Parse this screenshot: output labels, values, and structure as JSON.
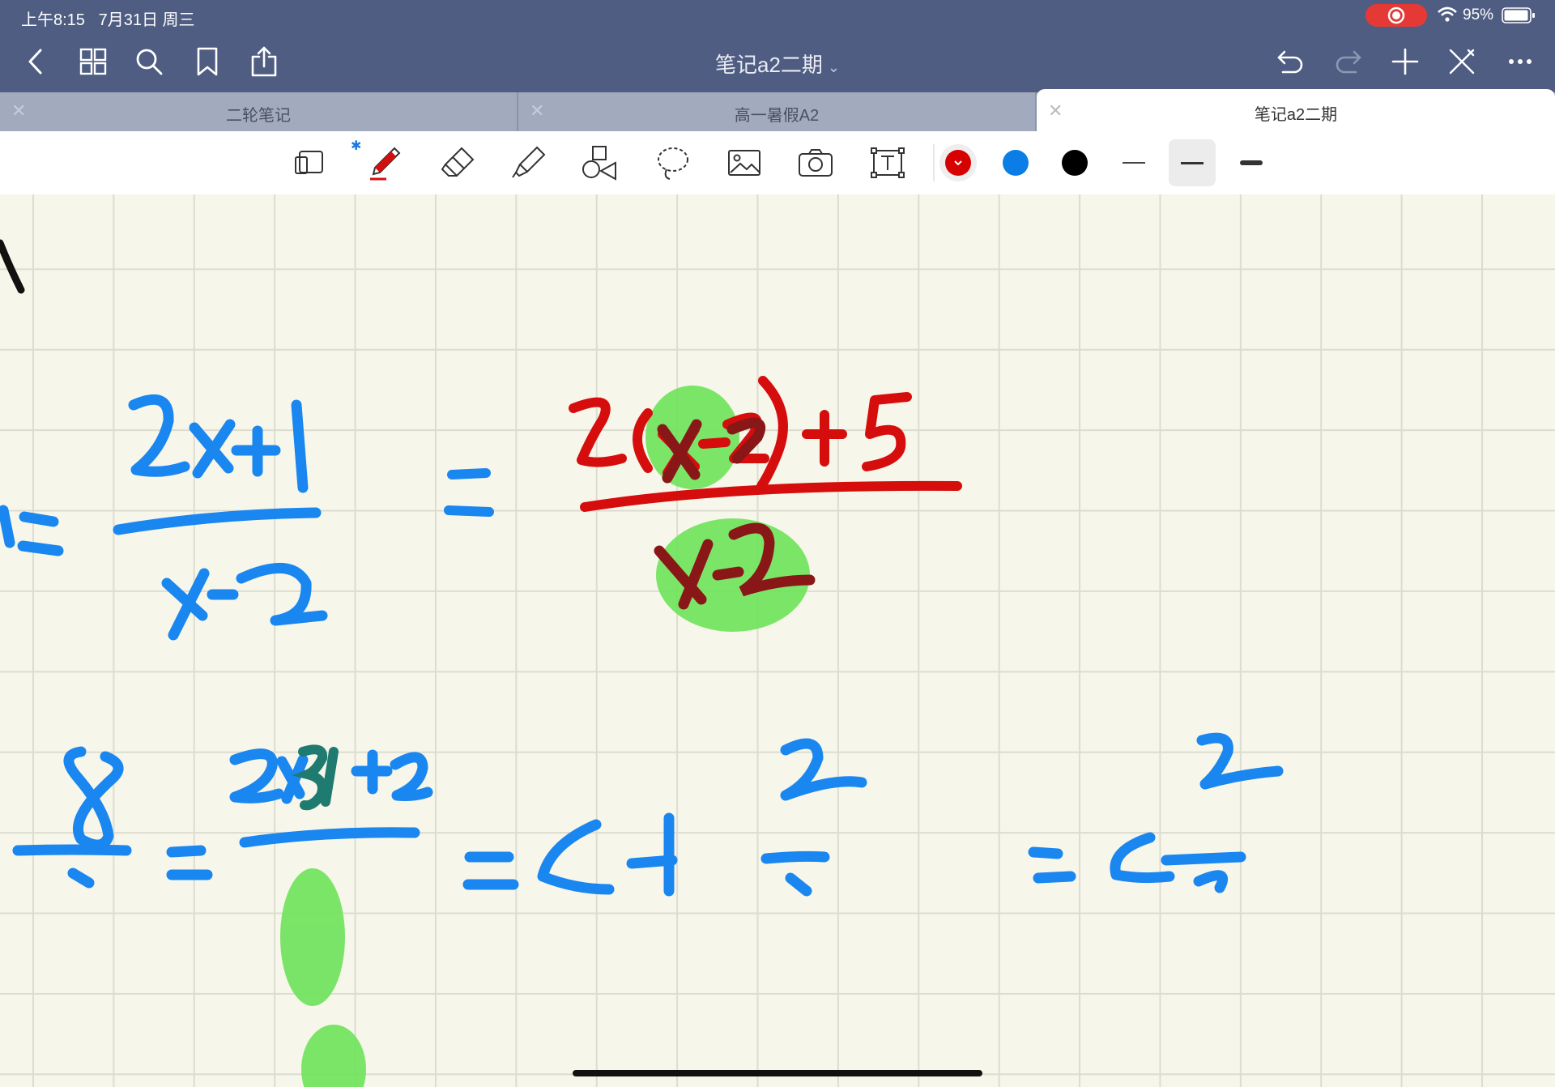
{
  "status": {
    "time": "上午8:15",
    "date": "7月31日 周三",
    "battery_pct": "95%",
    "rec_color": "#e53935"
  },
  "nav": {
    "title": "笔记a2二期",
    "title_chevron": "⌄",
    "icons_left": [
      "back-icon",
      "grid-icon",
      "search-icon",
      "bookmark-icon",
      "share-icon"
    ],
    "icons_right": [
      "undo-icon",
      "redo-icon",
      "add-icon",
      "close-pen-icon",
      "more-icon"
    ]
  },
  "tabs": [
    {
      "label": "二轮笔记",
      "active": false
    },
    {
      "label": "高一暑假A2",
      "active": false
    },
    {
      "label": "笔记a2二期",
      "active": true
    }
  ],
  "toolbar": {
    "tools": [
      "page-mode-icon",
      "pen-icon",
      "eraser-icon",
      "highlighter-icon",
      "shapes-icon",
      "lasso-icon",
      "image-icon",
      "camera-icon",
      "text-icon"
    ],
    "bluetooth": "✱",
    "colors": [
      "#d60000",
      "#0a7de6",
      "#000000"
    ],
    "selected_color": "#d60000",
    "stroke_sizes": [
      "thin",
      "medium",
      "thick"
    ],
    "selected_stroke": "medium"
  },
  "canvas": {
    "ink_colors": {
      "blue": "#1a86f0",
      "red": "#d60d0d",
      "green_highlight": "#6de35a"
    }
  }
}
